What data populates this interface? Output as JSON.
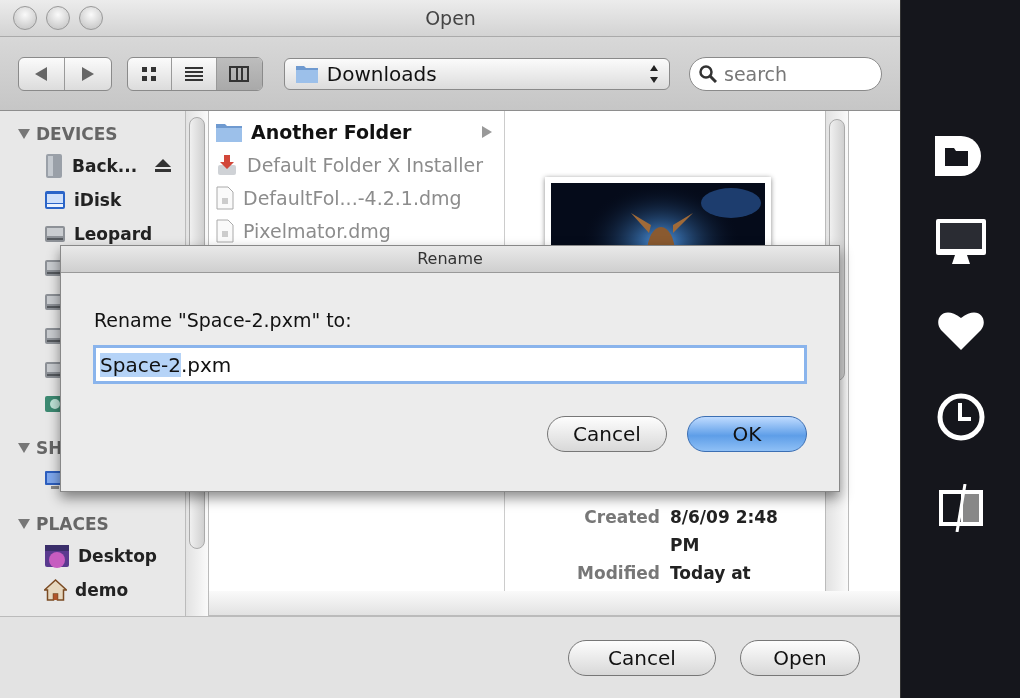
{
  "window": {
    "title": "Open"
  },
  "toolbar": {
    "view_modes": [
      {
        "kind": "icons",
        "selected": false
      },
      {
        "kind": "list",
        "selected": false
      },
      {
        "kind": "columns",
        "selected": true
      }
    ],
    "location": "Downloads",
    "search": {
      "placeholder": "search"
    }
  },
  "sidebar": {
    "sections": [
      {
        "heading": "DEVICES",
        "items": [
          {
            "label": "Back...",
            "kind": "drive",
            "eject": true
          },
          {
            "label": "iDisk",
            "kind": "idisk",
            "eject": false
          },
          {
            "label": "Leopard",
            "kind": "disk",
            "eject": false
          },
          {
            "kind": "disk",
            "eject": false
          },
          {
            "kind": "disk",
            "eject": false
          },
          {
            "kind": "disk",
            "eject": false
          },
          {
            "kind": "disk",
            "eject": false
          },
          {
            "kind": "cd",
            "eject": false
          }
        ]
      },
      {
        "heading": "SH",
        "items": [
          {
            "kind": "computer",
            "eject": false
          }
        ]
      },
      {
        "heading": "PLACES",
        "items": [
          {
            "label": "Desktop",
            "kind": "desktop",
            "eject": false
          },
          {
            "label": "demo",
            "kind": "home",
            "eject": false
          }
        ]
      }
    ]
  },
  "files": [
    {
      "name": "Another Folder",
      "kind": "folder",
      "disabled": false,
      "has_children": true
    },
    {
      "name": "Default Folder X Installer",
      "kind": "installer",
      "disabled": true,
      "has_children": false
    },
    {
      "name": "DefaultFol...-4.2.1.dmg",
      "kind": "document",
      "disabled": true,
      "has_children": false
    },
    {
      "name": "Pixelmator.dmg",
      "kind": "document",
      "disabled": true,
      "has_children": false
    }
  ],
  "preview": {
    "kind": "picture",
    "info": [
      {
        "label": "Created",
        "value": "8/6/09 2:48 PM"
      },
      {
        "label": "Modified",
        "value": "Today at"
      }
    ]
  },
  "rename_sheet": {
    "title": "Rename",
    "prompt": "Rename \"Space-2.pxm\" to:",
    "value_selected": "Space-2",
    "value_rest": ".pxm",
    "buttons": [
      {
        "label": "Cancel",
        "default": false
      },
      {
        "label": "OK",
        "default": true
      }
    ]
  },
  "buttons": [
    {
      "label": "Cancel",
      "default": false
    },
    {
      "label": "Open",
      "default": false
    }
  ],
  "dock": [
    {
      "kind": "documents"
    },
    {
      "kind": "computer"
    },
    {
      "kind": "favorites"
    },
    {
      "kind": "recent"
    },
    {
      "kind": "finder"
    }
  ]
}
